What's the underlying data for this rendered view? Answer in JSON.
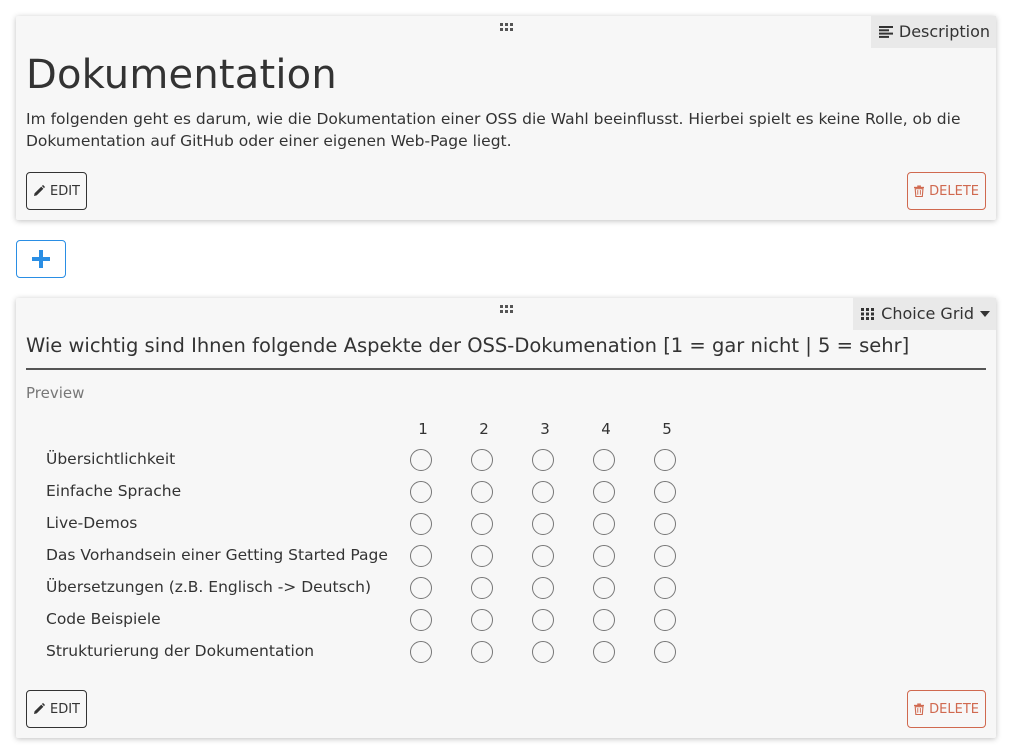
{
  "description_block": {
    "type_label": "Description",
    "type_icon": "align-left-icon",
    "title": "Dokumentation",
    "text": "Im folgenden geht es darum, wie die Dokumentation einer OSS die Wahl beeinflusst. Hierbei spielt es keine Rolle, ob die Dokumentation auf GitHub oder einer eigenen Web-Page liegt.",
    "edit_label": "EDIT",
    "delete_label": "DELETE"
  },
  "add_button": {
    "icon": "plus-icon",
    "color": "#2a8ee4"
  },
  "choice_grid_block": {
    "type_label": "Choice Grid",
    "type_icon": "grid-icon",
    "question": "Wie wichtig sind Ihnen folgende Aspekte der OSS-Dokumenation [1 = gar nicht | 5 = sehr]",
    "preview_label": "Preview",
    "columns": [
      "1",
      "2",
      "3",
      "4",
      "5"
    ],
    "rows": [
      "Übersichtlichkeit",
      "Einfache Sprache",
      "Live-Demos",
      "Das Vorhandsein einer Getting Started Page",
      "Übersetzungen (z.B. Englisch -> Deutsch)",
      "Code Beispiele",
      "Strukturierung der Dokumentation"
    ],
    "edit_label": "EDIT",
    "delete_label": "DELETE"
  },
  "colors": {
    "delete": "#d0694f",
    "accent": "#2a8ee4",
    "card_bg": "#f7f7f7"
  }
}
